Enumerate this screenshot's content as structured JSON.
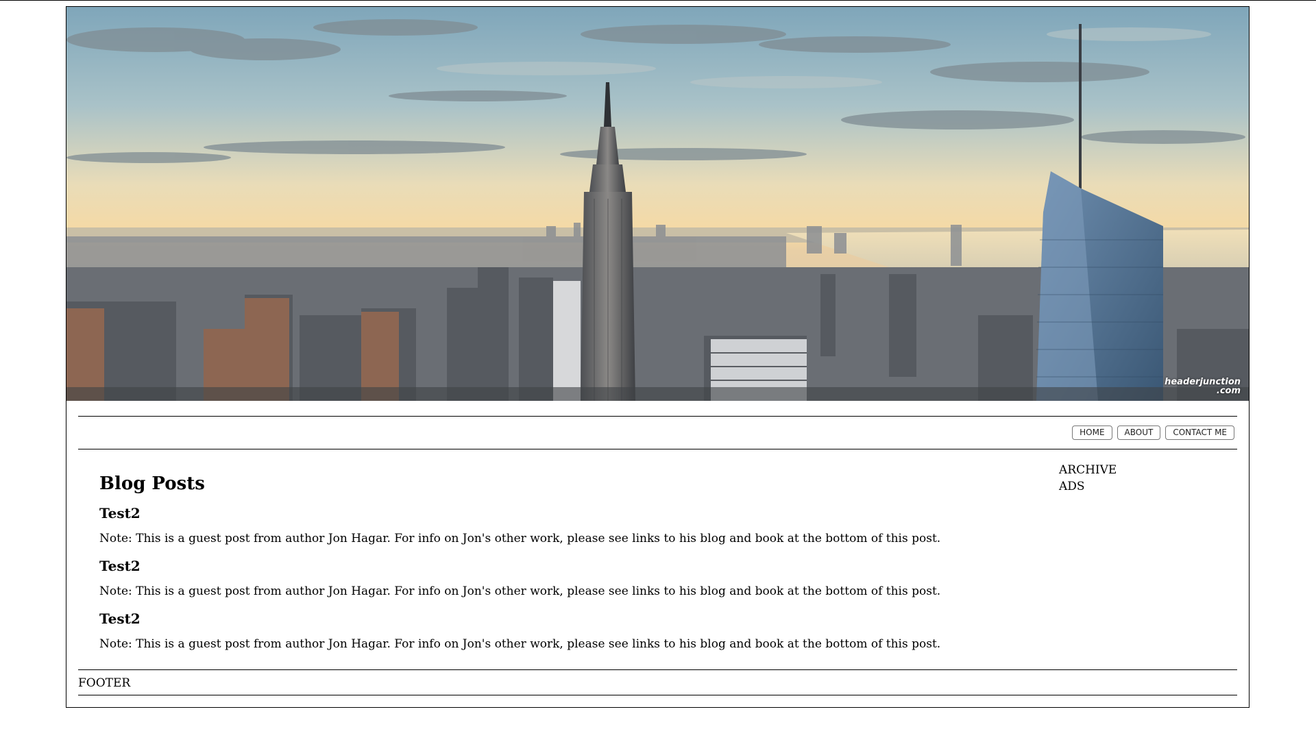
{
  "banner": {
    "watermark_line1": "headerjunction",
    "watermark_line2": ".com",
    "description": ""
  },
  "nav": {
    "items": [
      {
        "label": "HOME"
      },
      {
        "label": "ABOUT"
      },
      {
        "label": "CONTACT ME"
      }
    ]
  },
  "main": {
    "heading": "Blog Posts",
    "posts": [
      {
        "title": "Test2",
        "excerpt": "Note: This is a guest post from author Jon Hagar. For info on Jon's other work, please see links to his blog and book at the bottom of this post."
      },
      {
        "title": "Test2",
        "excerpt": "Note: This is a guest post from author Jon Hagar. For info on Jon's other work, please see links to his blog and book at the bottom of this post."
      },
      {
        "title": "Test2",
        "excerpt": "Note: This is a guest post from author Jon Hagar. For info on Jon's other work, please see links to his blog and book at the bottom of this post."
      }
    ]
  },
  "sidebar": {
    "archive": "ARCHIVE",
    "ads": "ADS"
  },
  "footer": {
    "text": "FOOTER"
  },
  "colors": {
    "sky_top": "#8fb3c4",
    "sky_horizon": "#f3dcae",
    "city": "#5a5f66"
  }
}
